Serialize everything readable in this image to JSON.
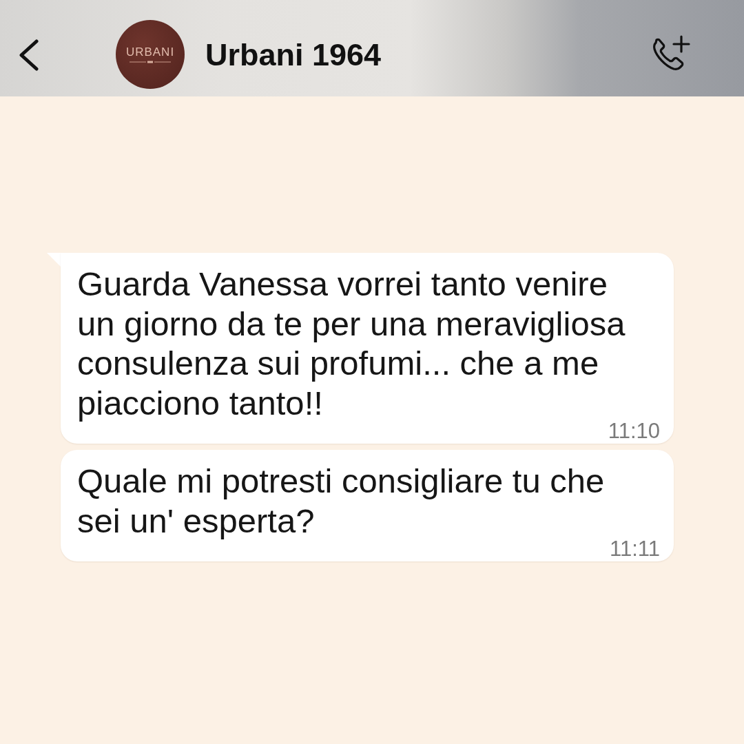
{
  "header": {
    "avatar_text": "URBANI",
    "title": "Urbani 1964"
  },
  "messages": [
    {
      "text": "Guarda Vanessa vorrei tanto venire un giorno da te per una meravigliosa consulenza sui profumi... che a me piacciono tanto!!",
      "time": "11:10",
      "tail": true
    },
    {
      "text": "Quale mi potresti consigliare tu che sei un' esperta?",
      "time": "11:11",
      "tail": false
    }
  ]
}
